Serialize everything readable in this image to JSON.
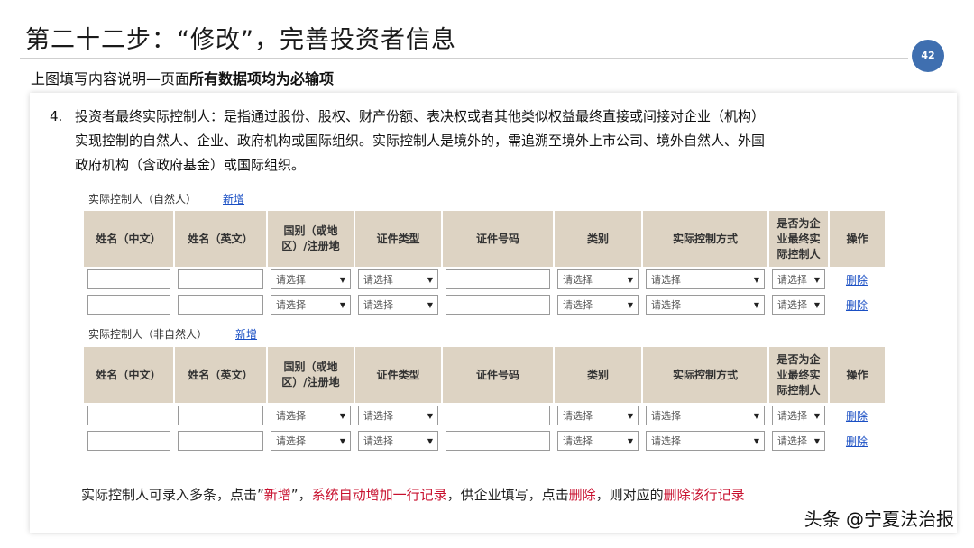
{
  "slide": {
    "title": "第二十二步：“修改”，完善投资者信息",
    "page_number": "42",
    "subtitle_plain": "上图填写内容说明—页面",
    "subtitle_bold": "所有数据项均为必输项"
  },
  "description": {
    "number": "4.",
    "line1": "投资者最终实际控制人：是指通过股份、股权、财产份额、表决权或者其他类似权益最终直接或间接对企业（机构）",
    "line2": "实现控制的自然人、企业、政府机构或国际组织。实际控制人是境外的，需追溯至境外上市公司、境外自然人、外国",
    "line3": "政府机构（含政府基金）或国际组织。"
  },
  "columns": [
    "姓名（中文）",
    "姓名（英文）",
    "国别（或地区）/注册地",
    "证件类型",
    "证件号码",
    "类别",
    "实际控制方式",
    "是否为企业最终实际控制人",
    "操作"
  ],
  "select_placeholder": "请选择",
  "select_placeholder_short": "请选择",
  "delete_label": "删除",
  "natural": {
    "label": "实际控制人（自然人）",
    "add_label": "新增"
  },
  "nonnatural": {
    "label": "实际控制人（非自然人）",
    "add_label": "新增"
  },
  "note": {
    "p1": "实际控制人可录入多条，点击”",
    "p2": "新增",
    "p3": "”，",
    "p4": "系统自动增加一行记录",
    "p5": "，供企业填写，点击",
    "p6": "删除",
    "p7": "，则对应的",
    "p8": "删除该行记录"
  },
  "watermark": "头条 @宁夏法治报",
  "colors": {
    "header_bg": "#ddd3c3",
    "link": "#1a4fc4",
    "highlight": "#c8102e",
    "badge": "#3f6fb0"
  }
}
